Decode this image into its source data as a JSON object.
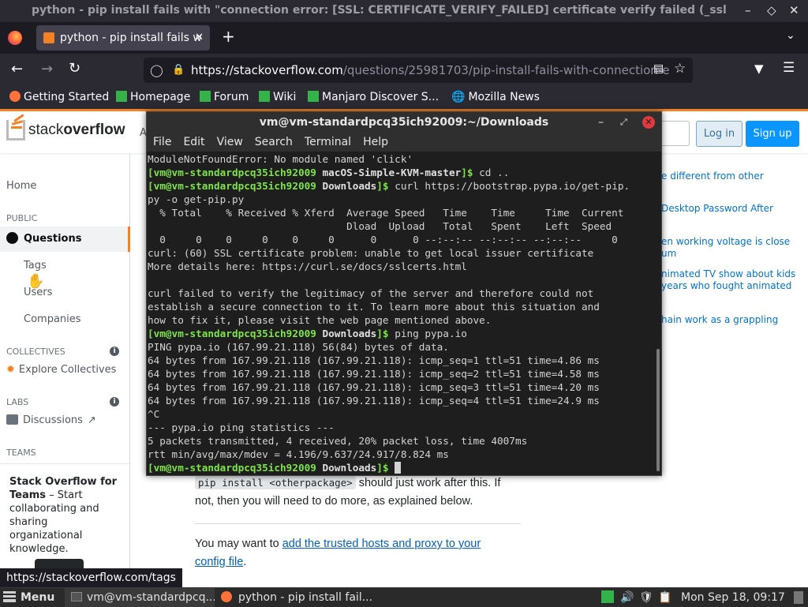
{
  "window": {
    "title": "python - pip install fails with \"connection error: [SSL: CERTIFICATE_VERIFY_FAILED] certificate verify failed (_ssl.c..."
  },
  "browser": {
    "tab_title": "python - pip install fails w",
    "url_host": "https://stackoverflow.com",
    "url_path": "/questions/25981703/pip-install-fails-with-connection-e",
    "bookmarks": [
      "Getting Started",
      "Homepage",
      "Forum",
      "Wiki",
      "Manjaro Discover S...",
      "Mozilla News"
    ],
    "status_url": "https://stackoverflow.com/tags"
  },
  "so": {
    "logo_a": "stack",
    "logo_b": "overflow",
    "nav_partial": "A",
    "login": "Log in",
    "signup": "Sign up",
    "sidebar": {
      "home": "Home",
      "public": "PUBLIC",
      "questions": "Questions",
      "tags": "Tags",
      "users": "Users",
      "companies": "Companies",
      "collectives": "COLLECTIVES",
      "explore": "Explore Collectives",
      "labs": "LABS",
      "discussions": "Discussions",
      "teams": "TEAMS",
      "teams_bold": "Stack Overflow for Teams",
      "teams_text": " – Start collaborating and sharing organizational knowledge."
    },
    "right_links": [
      "e different from other",
      "Desktop Password After",
      "en working voltage is close",
      "um",
      "nimated TV show about kids",
      "years who fought animated",
      "hain work as a grappling"
    ],
    "answer": {
      "code": "pip install <otherpackage>",
      "text1": " should just work after this. If",
      "text2": "not, then you will need to do more, as explained below.",
      "text3": "You may want to ",
      "link1": "add the trusted hosts and proxy to your",
      "link2": "config file",
      "dot": "."
    }
  },
  "terminal": {
    "title": "vm@vm-standardpcq35ich92009:~/Downloads",
    "menu": [
      "File",
      "Edit",
      "View",
      "Search",
      "Terminal",
      "Help"
    ],
    "lines": [
      {
        "t": "ModuleNotFoundError: No module named 'click'"
      },
      {
        "p": "[vm@vm-standardpcq35ich92009 ",
        "w": "macOS-Simple-KVM-master",
        "e": "]$ ",
        "t": "cd .."
      },
      {
        "p": "[vm@vm-standardpcq35ich92009 ",
        "w": "Downloads",
        "e": "]$ ",
        "t": "curl https://bootstrap.pypa.io/get-pip."
      },
      {
        "t": "py -o get-pip.py"
      },
      {
        "t": "  % Total    % Received % Xferd  Average Speed   Time    Time     Time  Current"
      },
      {
        "t": "                                 Dload  Upload   Total   Spent    Left  Speed"
      },
      {
        "t": "  0     0    0     0    0     0      0      0 --:--:-- --:--:-- --:--:--     0"
      },
      {
        "t": "curl: (60) SSL certificate problem: unable to get local issuer certificate"
      },
      {
        "t": "More details here: https://curl.se/docs/sslcerts.html"
      },
      {
        "t": ""
      },
      {
        "t": "curl failed to verify the legitimacy of the server and therefore could not"
      },
      {
        "t": "establish a secure connection to it. To learn more about this situation and"
      },
      {
        "t": "how to fix it, please visit the web page mentioned above."
      },
      {
        "p": "[vm@vm-standardpcq35ich92009 ",
        "w": "Downloads",
        "e": "]$ ",
        "t": "ping pypa.io"
      },
      {
        "t": "PING pypa.io (167.99.21.118) 56(84) bytes of data."
      },
      {
        "t": "64 bytes from 167.99.21.118 (167.99.21.118): icmp_seq=1 ttl=51 time=4.86 ms"
      },
      {
        "t": "64 bytes from 167.99.21.118 (167.99.21.118): icmp_seq=2 ttl=51 time=4.58 ms"
      },
      {
        "t": "64 bytes from 167.99.21.118 (167.99.21.118): icmp_seq=3 ttl=51 time=4.20 ms"
      },
      {
        "t": "64 bytes from 167.99.21.118 (167.99.21.118): icmp_seq=4 ttl=51 time=24.9 ms"
      },
      {
        "t": "^C"
      },
      {
        "t": "--- pypa.io ping statistics ---"
      },
      {
        "t": "5 packets transmitted, 4 received, 20% packet loss, time 4007ms"
      },
      {
        "t": "rtt min/avg/max/mdev = 4.196/9.637/24.917/8.824 ms"
      },
      {
        "p": "[vm@vm-standardpcq35ich92009 ",
        "w": "Downloads",
        "e": "]$ ",
        "t": ""
      }
    ]
  },
  "taskbar": {
    "menu": "Menu",
    "task1": "vm@vm-standardpcq...",
    "task2": "python - pip install fail...",
    "clock": "Mon Sep 18, 09:17"
  },
  "colors": {
    "so_orange": "#f48225",
    "so_blue": "#0a95ff",
    "prompt_green": "#7fe34a"
  }
}
